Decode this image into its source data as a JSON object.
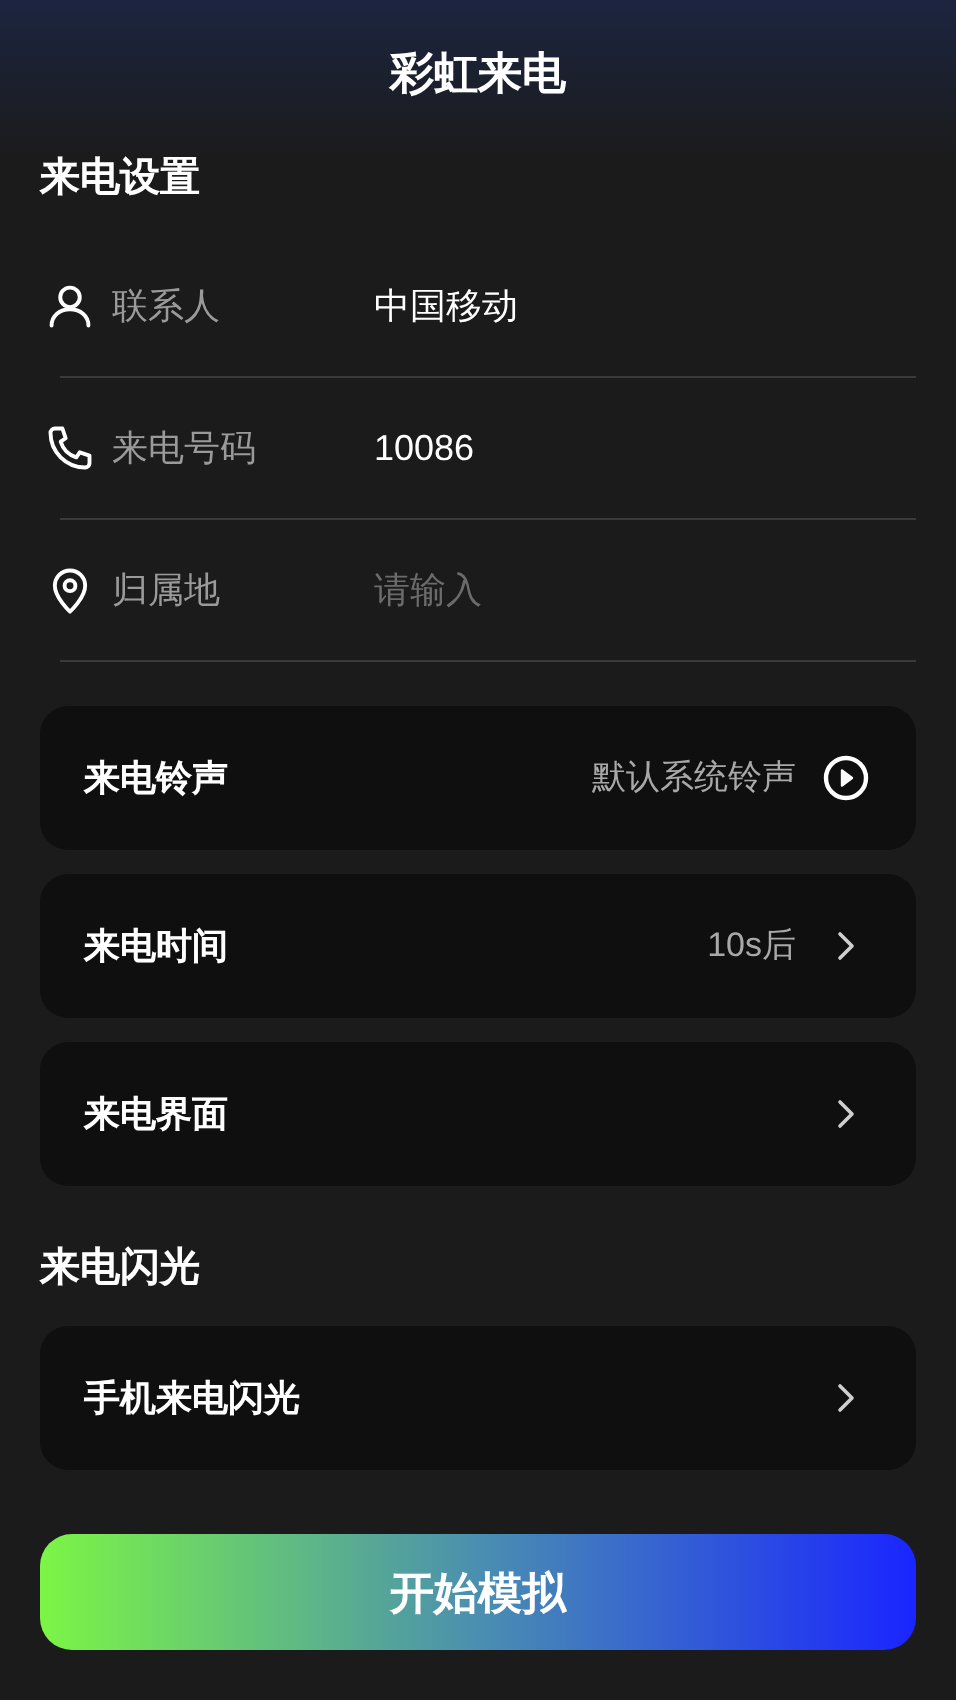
{
  "title": "彩虹来电",
  "sections": [
    {
      "heading": "来电设置",
      "fields": [
        {
          "label": "联系人",
          "value": "中国移动"
        },
        {
          "label": "来电号码",
          "value": "10086"
        },
        {
          "label": "归属地",
          "placeholder": "请输入"
        }
      ],
      "rows": [
        {
          "kind": "audio",
          "label": "来电铃声",
          "value": "默认系统铃声"
        },
        {
          "kind": "link",
          "label": "来电时间",
          "value": "10s后"
        },
        {
          "kind": "link",
          "label": "来电界面"
        }
      ]
    },
    {
      "heading": "来电闪光",
      "rows": [
        {
          "kind": "link",
          "label": "手机来电闪光"
        }
      ]
    }
  ],
  "primary_button": "开始模拟"
}
